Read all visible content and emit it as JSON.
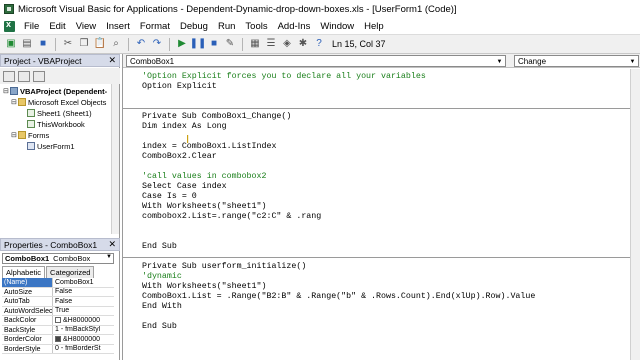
{
  "window": {
    "title": "Microsoft Visual Basic for Applications - Dependent-Dynamic-drop-down-boxes.xls - [UserForm1 (Code)]"
  },
  "menu": [
    "File",
    "Edit",
    "View",
    "Insert",
    "Format",
    "Debug",
    "Run",
    "Tools",
    "Add-Ins",
    "Window",
    "Help"
  ],
  "toolbar": {
    "position": "Ln 15, Col 37"
  },
  "project": {
    "title": "Project - VBAProject",
    "tree": [
      {
        "label": "VBAProject (Dependent-",
        "icon": "vba-project-icon",
        "bold": true
      },
      {
        "label": "Microsoft Excel Objects",
        "icon": "folder-icon",
        "bold": false
      },
      {
        "label": "Sheet1 (Sheet1)",
        "icon": "sheet-icon",
        "bold": false
      },
      {
        "label": "ThisWorkbook",
        "icon": "workbook-icon",
        "bold": false
      },
      {
        "label": "Forms",
        "icon": "folder-icon",
        "bold": false
      },
      {
        "label": "UserForm1",
        "icon": "userform-icon",
        "bold": false
      }
    ]
  },
  "properties": {
    "title": "Properties - ComboBox1",
    "object_name": "ComboBox1",
    "object_type": "ComboBox",
    "tabs": [
      "Alphabetic",
      "Categorized"
    ],
    "rows": [
      {
        "key": "(Name)",
        "value": "ComboBox1"
      },
      {
        "key": "AutoSize",
        "value": "False"
      },
      {
        "key": "AutoTab",
        "value": "False"
      },
      {
        "key": "AutoWordSelect",
        "value": "True"
      },
      {
        "key": "BackColor",
        "value": "&H8000000"
      },
      {
        "key": "BackStyle",
        "value": "1 - fmBackStyl"
      },
      {
        "key": "BorderColor",
        "value": "&H8000000"
      },
      {
        "key": "BorderStyle",
        "value": "0 - fmBorderSt"
      }
    ],
    "colors": {
      "backcolor": "#ffffff",
      "bordercolor": "#444444"
    }
  },
  "code": {
    "object_combo": "ComboBox1",
    "proc_combo": "Change",
    "lines": [
      {
        "text": "'Option Explicit forces you to declare all your variables",
        "kind": "comment"
      },
      {
        "text": "Option Explicit",
        "kind": "code"
      },
      {
        "text": "",
        "kind": "code"
      },
      {
        "text": "",
        "kind": "code"
      },
      {
        "text": "Private Sub ComboBox1_Change()",
        "kind": "code"
      },
      {
        "text": "Dim index As Long",
        "kind": "code"
      },
      {
        "text": "",
        "kind": "code"
      },
      {
        "text": "index = ComboBox1.ListIndex",
        "kind": "code"
      },
      {
        "text": "ComboBox2.Clear",
        "kind": "code"
      },
      {
        "text": "",
        "kind": "code"
      },
      {
        "text": "'call values in combobox2",
        "kind": "comment"
      },
      {
        "text": "Select Case index",
        "kind": "code"
      },
      {
        "text": "Case Is = 0",
        "kind": "code"
      },
      {
        "text": "With Worksheets(\"sheet1\")",
        "kind": "code"
      },
      {
        "text": "combobox2.List=.range(\"c2:C\" & .rang",
        "kind": "code"
      },
      {
        "text": "",
        "kind": "code"
      },
      {
        "text": "",
        "kind": "code"
      },
      {
        "text": "End Sub",
        "kind": "code"
      },
      {
        "text": "",
        "kind": "code"
      },
      {
        "text": "Private Sub userform_initialize()",
        "kind": "code"
      },
      {
        "text": "'dynamic",
        "kind": "comment"
      },
      {
        "text": "With Worksheets(\"sheet1\")",
        "kind": "code"
      },
      {
        "text": "ComboBox1.List = .Range(\"B2:B\" & .Range(\"b\" & .Rows.Count).End(xlUp).Row).Value",
        "kind": "code"
      },
      {
        "text": "End With",
        "kind": "code"
      },
      {
        "text": "",
        "kind": "code"
      },
      {
        "text": "End Sub",
        "kind": "code"
      }
    ]
  }
}
